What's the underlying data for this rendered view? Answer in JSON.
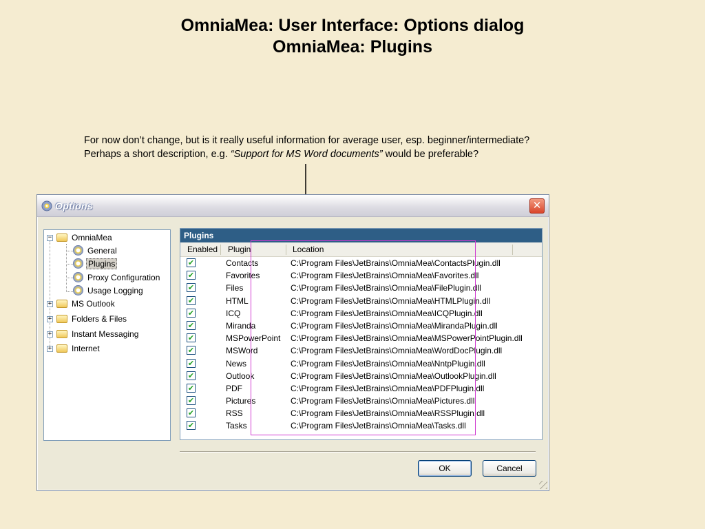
{
  "slide": {
    "title_line1": "OmniaMea: User Interface: Options dialog",
    "title_line2": "OmniaMea: Plugins"
  },
  "annotation": {
    "line1": "For now don’t change, but is it really useful information for average user, esp. beginner/intermediate?",
    "line2_prefix": "Perhaps a short description, e.g. ",
    "line2_quote": "“Support for MS Word documents”",
    "line2_suffix": " would be preferable?"
  },
  "window": {
    "title": "Options",
    "close_glyph": "✕"
  },
  "tree": {
    "root": "OmniaMea",
    "children": [
      "General",
      "Plugins",
      "Proxy Configuration",
      "Usage Logging"
    ],
    "selected": "Plugins",
    "groups": [
      "MS Outlook",
      "Folders & Files",
      "Instant Messaging",
      "Internet"
    ],
    "collapse_glyph": "−",
    "expand_glyph": "+"
  },
  "panel": {
    "header": "Plugins",
    "columns": [
      "Enabled",
      "Plugin",
      "Location"
    ],
    "check_glyph": "✔",
    "rows": [
      {
        "enabled": true,
        "plugin": "Contacts",
        "location": "C:\\Program Files\\JetBrains\\OmniaMea\\ContactsPlugin.dll"
      },
      {
        "enabled": true,
        "plugin": "Favorites",
        "location": "C:\\Program Files\\JetBrains\\OmniaMea\\Favorites.dll"
      },
      {
        "enabled": true,
        "plugin": "Files",
        "location": "C:\\Program Files\\JetBrains\\OmniaMea\\FilePlugin.dll"
      },
      {
        "enabled": true,
        "plugin": "HTML",
        "location": "C:\\Program Files\\JetBrains\\OmniaMea\\HTMLPlugin.dll"
      },
      {
        "enabled": true,
        "plugin": "ICQ",
        "location": "C:\\Program Files\\JetBrains\\OmniaMea\\ICQPlugin.dll"
      },
      {
        "enabled": true,
        "plugin": "Miranda",
        "location": "C:\\Program Files\\JetBrains\\OmniaMea\\MirandaPlugin.dll"
      },
      {
        "enabled": true,
        "plugin": "MSPowerPoint",
        "location": "C:\\Program Files\\JetBrains\\OmniaMea\\MSPowerPointPlugin.dll"
      },
      {
        "enabled": true,
        "plugin": "MSWord",
        "location": "C:\\Program Files\\JetBrains\\OmniaMea\\WordDocPlugin.dll"
      },
      {
        "enabled": true,
        "plugin": "News",
        "location": "C:\\Program Files\\JetBrains\\OmniaMea\\NntpPlugin.dll"
      },
      {
        "enabled": true,
        "plugin": "Outlook",
        "location": "C:\\Program Files\\JetBrains\\OmniaMea\\OutlookPlugin.dll"
      },
      {
        "enabled": true,
        "plugin": "PDF",
        "location": "C:\\Program Files\\JetBrains\\OmniaMea\\PDFPlugin.dll"
      },
      {
        "enabled": true,
        "plugin": "Pictures",
        "location": "C:\\Program Files\\JetBrains\\OmniaMea\\Pictures.dll"
      },
      {
        "enabled": true,
        "plugin": "RSS",
        "location": "C:\\Program Files\\JetBrains\\OmniaMea\\RSSPlugin.dll"
      },
      {
        "enabled": true,
        "plugin": "Tasks",
        "location": "C:\\Program Files\\JetBrains\\OmniaMea\\Tasks.dll"
      }
    ]
  },
  "buttons": {
    "ok": "OK",
    "cancel": "Cancel"
  },
  "colors": {
    "background": "#f5ecd1",
    "panel_header": "#2e5e86",
    "highlight_box": "#d03ad0"
  }
}
